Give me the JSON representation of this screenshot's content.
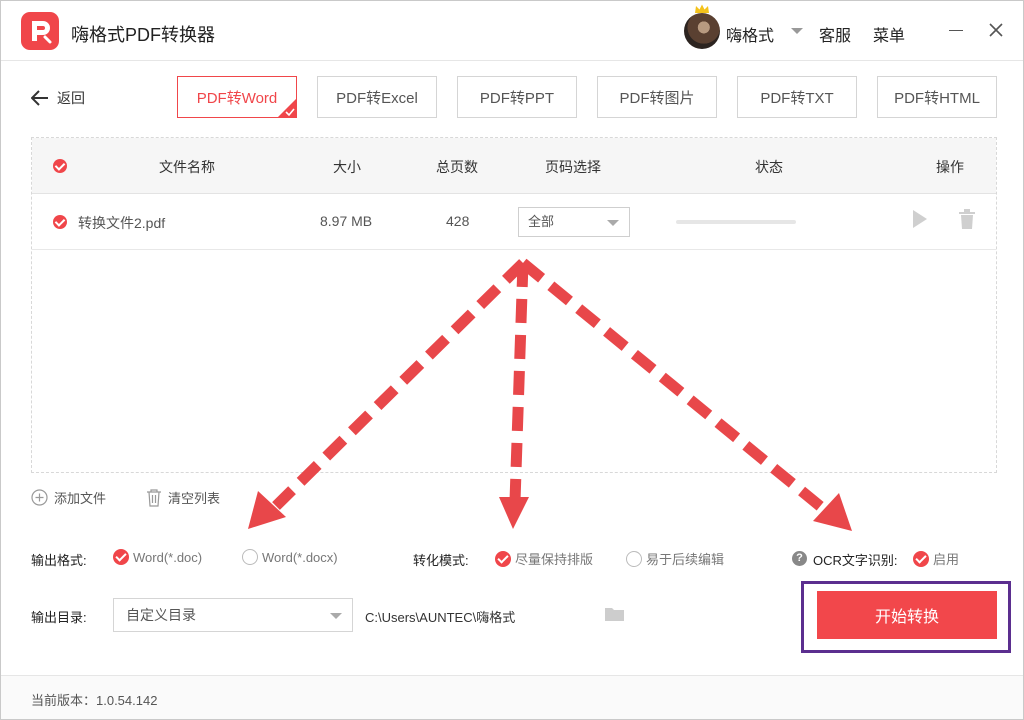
{
  "app": {
    "title": "嗨格式PDF转换器",
    "username": "嗨格式",
    "service": "客服",
    "menu": "菜单"
  },
  "nav": {
    "back": "返回"
  },
  "tabs": [
    {
      "label": "PDF转Word",
      "active": true
    },
    {
      "label": "PDF转Excel",
      "active": false
    },
    {
      "label": "PDF转PPT",
      "active": false
    },
    {
      "label": "PDF转图片",
      "active": false
    },
    {
      "label": "PDF转TXT",
      "active": false
    },
    {
      "label": "PDF转HTML",
      "active": false
    }
  ],
  "table": {
    "headers": {
      "name": "文件名称",
      "size": "大小",
      "pages": "总页数",
      "page_select": "页码选择",
      "status": "状态",
      "actions": "操作"
    },
    "rows": [
      {
        "name": "转换文件2.pdf",
        "size": "8.97 MB",
        "pages": "428",
        "page_select": "全部",
        "progress": 0
      }
    ]
  },
  "actions": {
    "add_file": "添加文件",
    "clear_list": "清空列表"
  },
  "options": {
    "format_label": "输出格式:",
    "format_doc": "Word(*.doc)",
    "format_docx": "Word(*.docx)",
    "mode_label": "转化模式:",
    "mode_keep_layout": "尽量保持排版",
    "mode_easy_edit": "易于后续编辑",
    "ocr_label": "OCR文字识别:",
    "ocr_enable": "启用"
  },
  "output": {
    "dir_label": "输出目录:",
    "dir_select": "自定义目录",
    "dir_path": "C:\\Users\\AUNTEC\\嗨格式"
  },
  "start_button": "开始转换",
  "footer": {
    "version": "当前版本：1.0.54.142"
  },
  "colors": {
    "accent": "#f0464a",
    "highlight_border": "#5b2e8f",
    "arrow": "#e8474a"
  },
  "icons": [
    "logo-icon",
    "back-arrow-icon",
    "crown-icon",
    "close-icon",
    "minimize-icon",
    "play-icon",
    "trash-icon",
    "add-icon",
    "folder-icon",
    "help-icon"
  ]
}
